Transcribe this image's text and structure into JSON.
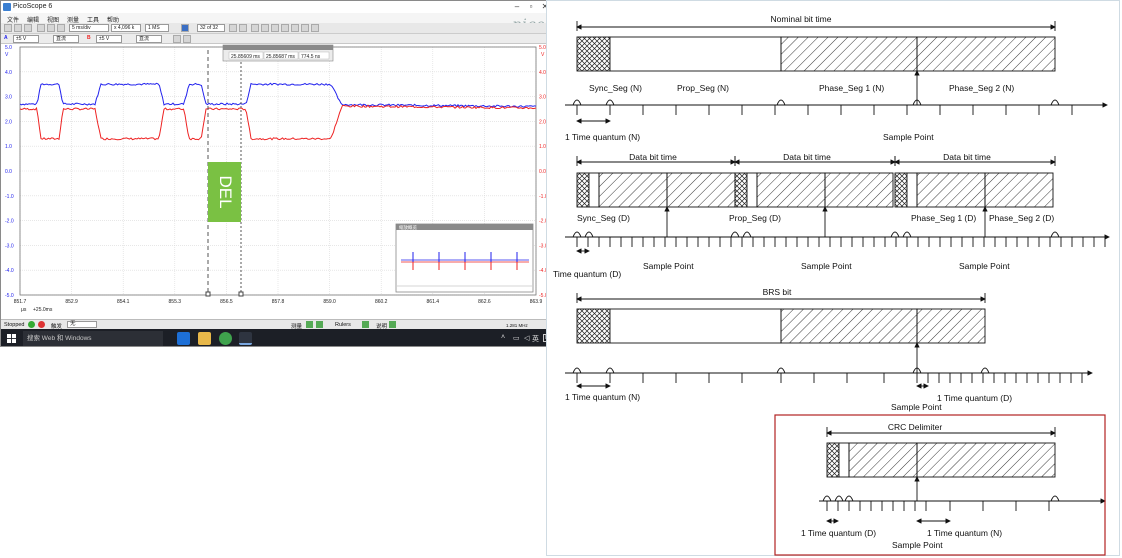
{
  "window": {
    "title": "PicoScope 6",
    "menu": [
      "文件",
      "编辑",
      "视图",
      "测量",
      "工具",
      "帮助"
    ],
    "logo": "pico"
  },
  "toolbar": {
    "timebase": "5 ms/div",
    "zoom": "x 4,096 k",
    "samples": "1 MS",
    "capture_index": "32 of 32"
  },
  "channels": {
    "a_label": "A",
    "a_range": "±5 V",
    "a_coupling": "直流",
    "b_label": "B",
    "b_range": "±5 V",
    "b_coupling": "直流"
  },
  "axes": {
    "left_unit": "V",
    "right_unit": "V",
    "left_ticks": [
      "5.0",
      "4.0",
      "3.0",
      "2.0",
      "1.0",
      "0.0",
      "-1.0",
      "-2.0",
      "-3.0",
      "-4.0",
      "-5.0"
    ],
    "right_ticks": [
      "5.0",
      "4.0",
      "3.0",
      "2.0",
      "1.0",
      "0.0",
      "-1.0",
      "-2.0",
      "-3.0",
      "-4.0",
      "-5.0"
    ],
    "x_ticks": [
      "851.7",
      "852.9",
      "854.1",
      "855.3",
      "856.5",
      "857.8",
      "859.0",
      "860.2",
      "861.4",
      "862.6",
      "863.9"
    ],
    "x_unit": "μs",
    "x_offset": "+25.0ms"
  },
  "ruler_readout": [
    "25.85609 ms",
    "25.85687 ms",
    "774.5 ns"
  ],
  "marker_label": "DEL",
  "overview": {
    "title": "缩放概览"
  },
  "statusbar": {
    "state": "Stopped",
    "trigger_label": "触发",
    "trigger_mode": "无",
    "measure_label": "测量",
    "rulers_label": "Rulers",
    "notes_label": "说明",
    "zoom_readout": "1.281 MHz"
  },
  "taskbar": {
    "search_placeholder": "搜索 Web 和 Windows",
    "ime": "英"
  },
  "diagram": {
    "nominal_bit_time": "Nominal bit time",
    "sync_seg_n": "Sync_Seg (N)",
    "prop_seg_n": "Prop_Seg (N)",
    "phase_seg1_n": "Phase_Seg 1 (N)",
    "phase_seg2_n": "Phase_Seg 2 (N)",
    "time_quantum_n": "1 Time quantum (N)",
    "sample_point": "Sample Point",
    "data_bit_time": "Data bit time",
    "sync_seg_d": "Sync_Seg (D)",
    "prop_seg_d": "Prop_Seg (D)",
    "phase_seg1_d": "Phase_Seg 1 (D)",
    "phase_seg2_d": "Phase_Seg 2 (D)",
    "time_quantum_d": "Time quantum (D)",
    "brs_bit": "BRS bit",
    "one_time_quantum_d": "1 Time quantum (D)",
    "crc_delimiter": "CRC Delimiter"
  },
  "colors": {
    "channel_a": "#2222ee",
    "channel_b": "#ee2222",
    "del_marker": "#7ac143",
    "highlight_box": "#b22222"
  }
}
